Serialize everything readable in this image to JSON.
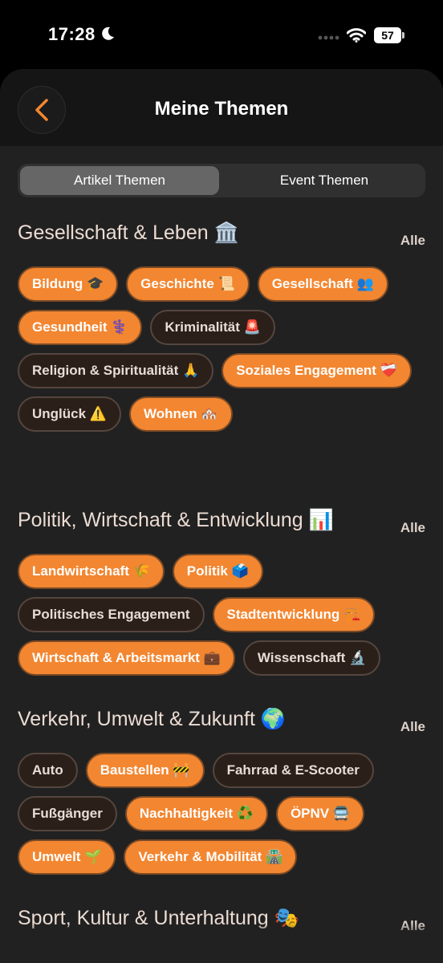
{
  "status_bar": {
    "time": "17:28",
    "battery": "57"
  },
  "header": {
    "title": "Meine Themen"
  },
  "tabs": {
    "active": "Artikel Themen",
    "inactive": "Event Themen"
  },
  "sections": [
    {
      "title": "Gesellschaft & Leben 🏛️",
      "all_label": "Alle",
      "chips": [
        {
          "label": "Bildung 🎓",
          "selected": true
        },
        {
          "label": "Geschichte 📜",
          "selected": true
        },
        {
          "label": "Gesellschaft 👥",
          "selected": true
        },
        {
          "label": "Gesundheit ⚕️",
          "selected": true
        },
        {
          "label": "Kriminalität 🚨",
          "selected": false
        },
        {
          "label": "Religion & Spiritualität 🙏",
          "selected": false
        },
        {
          "label": "Soziales Engagement ❤️‍🩹",
          "selected": true
        },
        {
          "label": "Unglück ⚠️",
          "selected": false
        },
        {
          "label": "Wohnen 🏘️",
          "selected": true
        }
      ]
    },
    {
      "title": "Politik, Wirtschaft & Entwicklung 📊",
      "all_label": "Alle",
      "chips": [
        {
          "label": "Landwirtschaft 🌾",
          "selected": true
        },
        {
          "label": "Politik 🗳️",
          "selected": true
        },
        {
          "label": "Politisches Engagement",
          "selected": false
        },
        {
          "label": "Stadtentwicklung 🏗️",
          "selected": true
        },
        {
          "label": "Wirtschaft & Arbeitsmarkt 💼",
          "selected": true
        },
        {
          "label": "Wissenschaft 🔬",
          "selected": false
        }
      ]
    },
    {
      "title": "Verkehr, Umwelt & Zukunft 🌍",
      "all_label": "Alle",
      "chips": [
        {
          "label": "Auto",
          "selected": false
        },
        {
          "label": "Baustellen 🚧",
          "selected": true
        },
        {
          "label": "Fahrrad & E-Scooter",
          "selected": false
        },
        {
          "label": "Fußgänger",
          "selected": false
        },
        {
          "label": "Nachhaltigkeit ♻️",
          "selected": true
        },
        {
          "label": "ÖPNV 🚍",
          "selected": true
        },
        {
          "label": "Umwelt 🌱",
          "selected": true
        },
        {
          "label": "Verkehr & Mobilität 🛣️",
          "selected": true
        }
      ]
    },
    {
      "title": "Sport, Kultur & Unterhaltung 🎭",
      "all_label": "Alle",
      "chips": []
    }
  ],
  "colors": {
    "accent": "#f38630",
    "chip_off": "#2b1f1a",
    "sheet": "#212121"
  },
  "icons": {
    "back": "chevron-left-icon",
    "moon": "moon-icon",
    "wifi": "wifi-icon"
  }
}
